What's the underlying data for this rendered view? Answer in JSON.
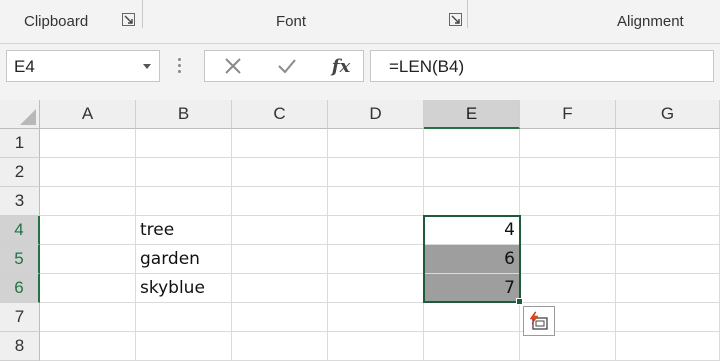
{
  "ribbon": {
    "groups": [
      {
        "label": "Clipboard"
      },
      {
        "label": "Font"
      },
      {
        "label": "Alignment"
      }
    ]
  },
  "formula_bar": {
    "name_box": "E4",
    "formula": "=LEN(B4)"
  },
  "columns": [
    "A",
    "B",
    "C",
    "D",
    "E",
    "F",
    "G"
  ],
  "rows": [
    "1",
    "2",
    "3",
    "4",
    "5",
    "6",
    "7",
    "8"
  ],
  "cells": {
    "B4": "tree",
    "B5": "garden",
    "B6": "skyblue",
    "E4": "4",
    "E5": "6",
    "E6": "7"
  },
  "selection": {
    "active_cell": "E4",
    "range": "E4:E6",
    "selected_column": "E",
    "selected_rows": [
      "4",
      "5",
      "6"
    ]
  },
  "colors": {
    "selection_border": "#1e5b3a",
    "range_fill": "#9e9e9e",
    "header_selected": "#d2d2d2"
  },
  "icons": {
    "cancel": "x-icon",
    "enter": "check-icon",
    "insert_function": "fx-icon",
    "quick_analysis": "quick-analysis-icon"
  }
}
